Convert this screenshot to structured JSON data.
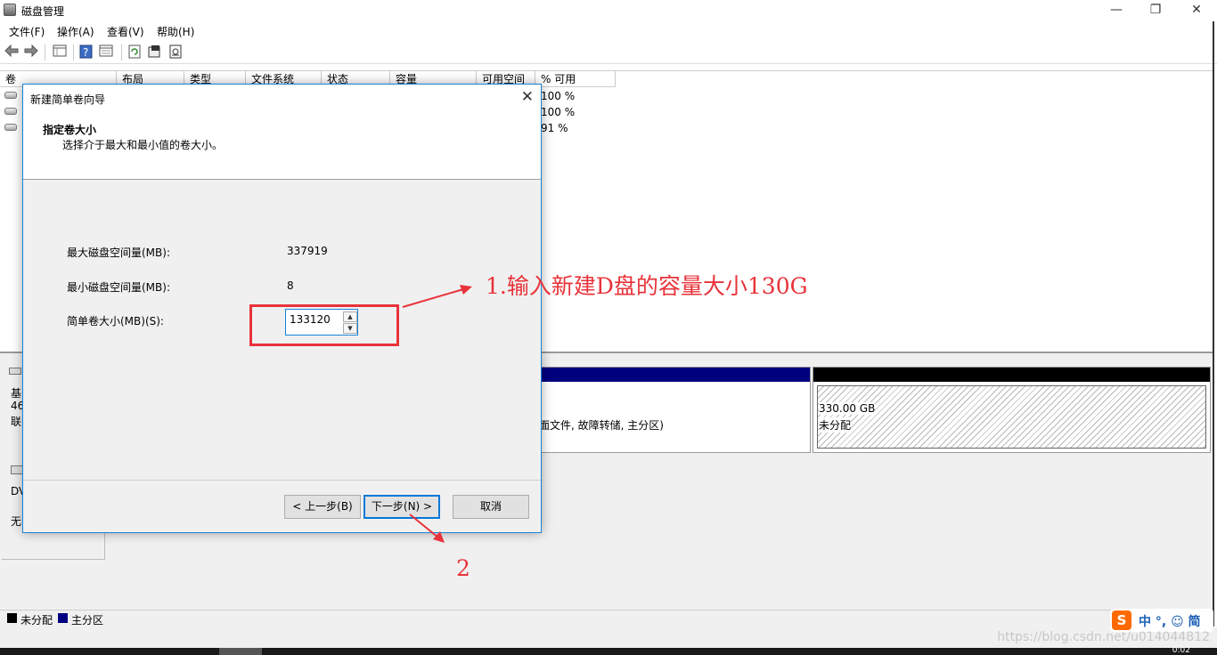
{
  "window": {
    "title": "磁盘管理",
    "controls": {
      "minimize": "—",
      "maximize": "❐",
      "close": "✕"
    }
  },
  "menu": [
    "文件(F)",
    "操作(A)",
    "查看(V)",
    "帮助(H)"
  ],
  "toolbar_icons": [
    "back-arrow-icon",
    "forward-arrow-icon",
    "disk-list-icon",
    "help-icon",
    "properties-icon",
    "refresh-icon",
    "settings-icon",
    "rescan-icon"
  ],
  "table": {
    "columns": [
      "卷",
      "布局",
      "类型",
      "文件系统",
      "状态",
      "容量",
      "可用空间",
      "% 可用"
    ],
    "rows": [
      {
        "pct": "100 %"
      },
      {
        "pct": "100 %"
      },
      {
        "pct": "91 %"
      }
    ]
  },
  "disk0": {
    "label_lines": [
      "基",
      "46",
      "联"
    ],
    "partition_desc": "面文件, 故障转储, 主分区)",
    "unallocated_size": "330.00 GB",
    "unallocated_label": "未分配"
  },
  "disk1": {
    "label_lines": [
      "DV",
      "无"
    ]
  },
  "legend": {
    "unallocated": "未分配",
    "primary": "主分区",
    "unallocated_color": "#000000",
    "primary_color": "#00007f"
  },
  "dialog": {
    "title": "新建简单卷向导",
    "heading": "指定卷大小",
    "subheading": "选择介于最大和最小值的卷大小。",
    "max_label": "最大磁盘空间量(MB):",
    "max_value": "337919",
    "min_label": "最小磁盘空间量(MB):",
    "min_value": "8",
    "size_label": "简单卷大小(MB)(S):",
    "size_value": "133120",
    "back_button": "< 上一步(B)",
    "next_button": "下一步(N) >",
    "cancel_button": "取消"
  },
  "annotations": {
    "step1": "1.输入新建D盘的容量大小130G",
    "step2": "2",
    "color": "#e8333a"
  },
  "ime": {
    "logo": "S",
    "text": "中 °, ☺ 简"
  },
  "watermark": "https://blog.csdn.net/u014044812",
  "clock": "0:02"
}
